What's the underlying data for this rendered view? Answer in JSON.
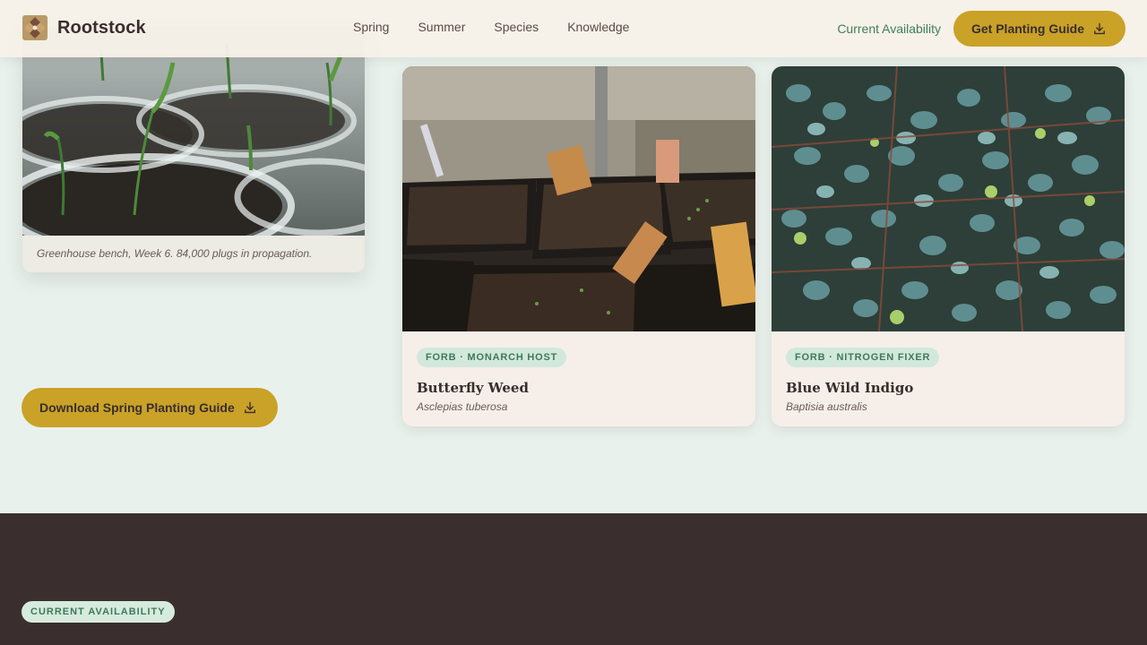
{
  "brand": {
    "name": "Rootstock"
  },
  "nav": {
    "items": [
      "Spring",
      "Summer",
      "Species",
      "Knowledge"
    ]
  },
  "header": {
    "availability_link": "Current Availability",
    "cta_label": "Get Planting Guide"
  },
  "hero": {
    "caption": "Greenhouse bench, Week 6. 84,000 plugs in propagation.",
    "download_button": "Download Spring Planting Guide"
  },
  "plants": [
    {
      "tag": "FORB · MONARCH HOST",
      "name": "Butterfly Weed",
      "scientific": "Asclepias tuberosa"
    },
    {
      "tag": "FORB · NITROGEN FIXER",
      "name": "Blue Wild Indigo",
      "scientific": "Baptisia australis"
    }
  ],
  "availability": {
    "badge": "CURRENT AVAILABILITY"
  },
  "colors": {
    "accent_gold": "#c9a227",
    "brand_dark": "#3b2e2f",
    "tag_green": "#3f7a58",
    "page_bg": "#e9f1ec"
  },
  "icons": {
    "download": "download-icon",
    "logo": "rootstock-logo-icon"
  }
}
